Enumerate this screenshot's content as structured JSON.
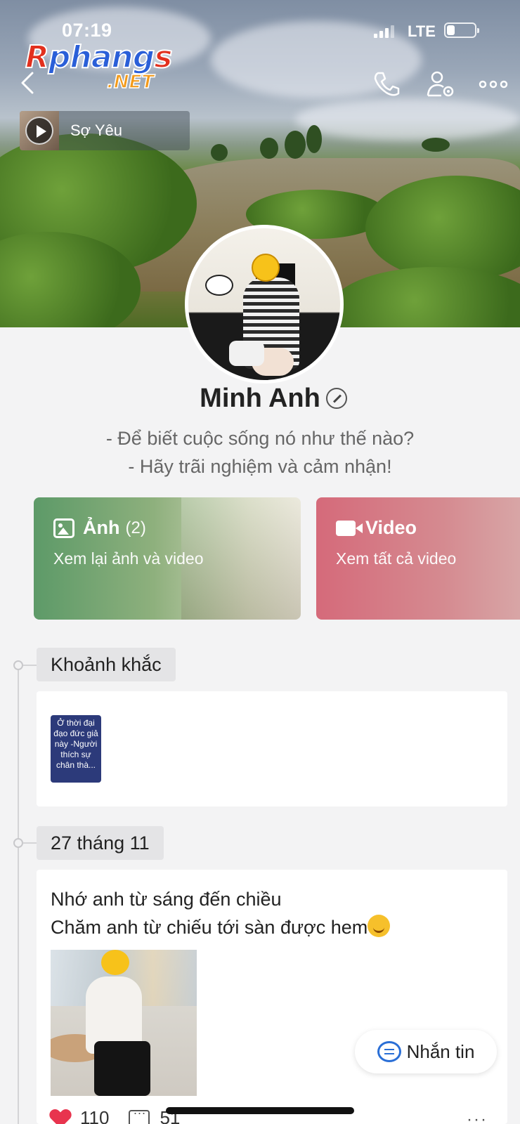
{
  "status_bar": {
    "time": "07:19",
    "network": "LTE",
    "battery_level": 0.3
  },
  "watermark": {
    "line1": "Rphangs",
    "line2": ".NET"
  },
  "header": {
    "icons": [
      "back-icon",
      "phone-icon",
      "person-gear-icon",
      "more-icon"
    ],
    "music": {
      "title": "Sợ Yêu"
    }
  },
  "profile": {
    "name": "Minh Anh",
    "bio_line1": "- Để biết cuộc sống nó như thế nào?",
    "bio_line2": "- Hãy trãi nghiệm và cảm nhận!"
  },
  "media_cards": {
    "photos": {
      "title": "Ảnh",
      "count": "(2)",
      "subtitle": "Xem lại ảnh và video",
      "color": "#5d9a68"
    },
    "videos": {
      "title": "Video",
      "subtitle": "Xem tất cả video",
      "color": "#d56a7a"
    }
  },
  "timeline": {
    "moments": {
      "label": "Khoảnh khắc",
      "story_text": "Ở thời đại đạo đức giả này -Người thích sự chân thà..."
    },
    "post": {
      "date_label": "27 tháng 11",
      "line1": "Nhớ anh từ sáng đến chiều",
      "line2": "Chăm anh từ chiếu tới sàn được hem",
      "likes": "110",
      "comments": "51",
      "more": "···"
    }
  },
  "chat_button": {
    "label": "Nhắn tin",
    "accent": "#2a6fd6"
  }
}
